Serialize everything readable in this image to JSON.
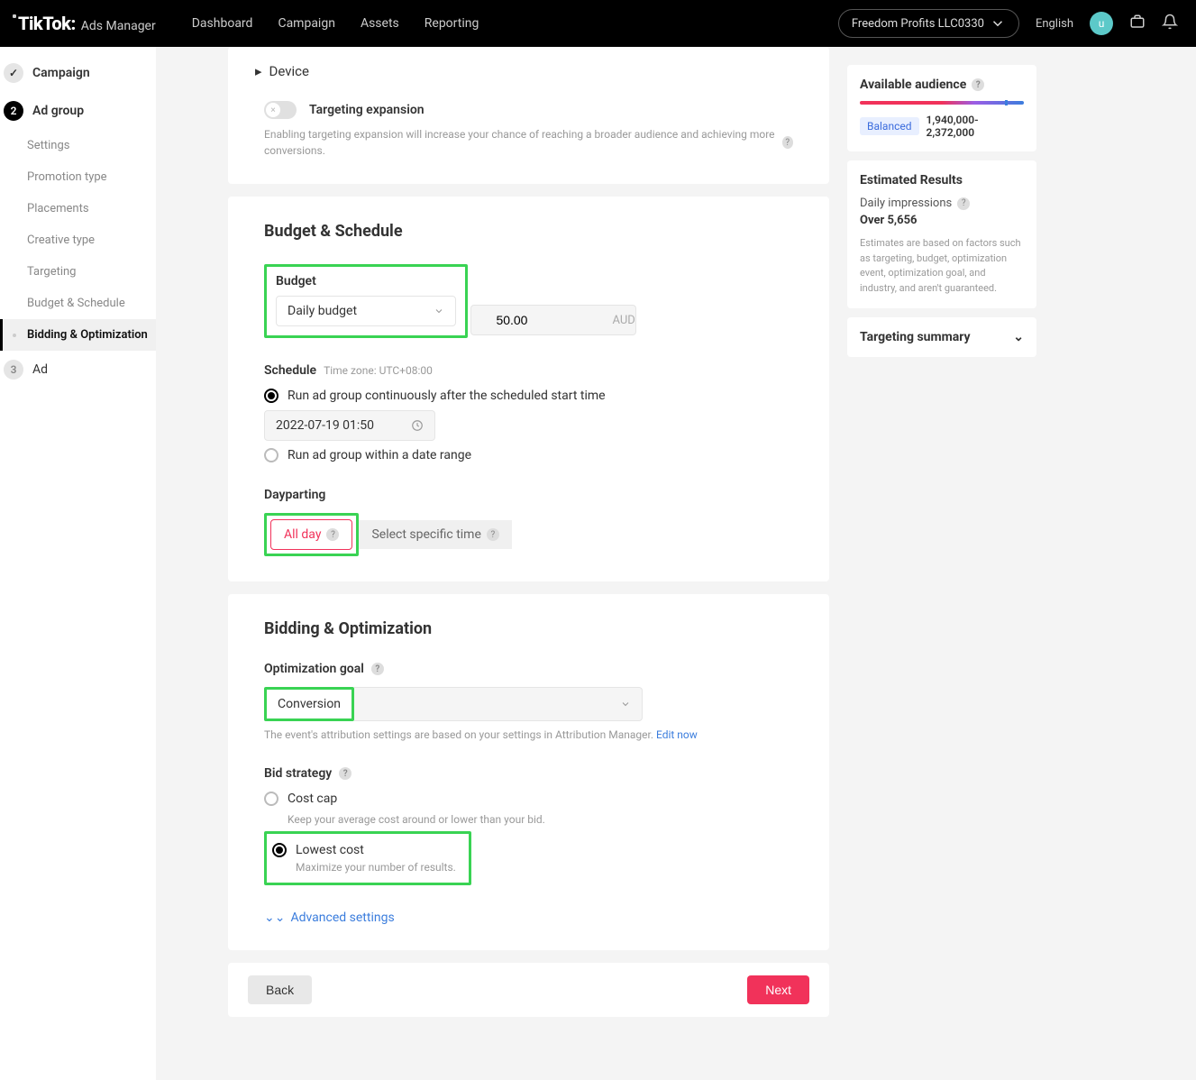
{
  "topbar": {
    "logo_main": "TikTok:",
    "logo_sub": "Ads Manager",
    "nav": [
      "Dashboard",
      "Campaign",
      "Assets",
      "Reporting"
    ],
    "account": "Freedom Profits LLC0330",
    "language": "English",
    "avatar_letter": "u"
  },
  "sidebar": {
    "steps": [
      {
        "label": "Campaign",
        "state": "done"
      },
      {
        "label": "Ad group",
        "state": "current",
        "num": "2"
      },
      {
        "label": "Ad",
        "state": "pending",
        "num": "3"
      }
    ],
    "subitems": [
      "Settings",
      "Promotion type",
      "Placements",
      "Creative type",
      "Targeting",
      "Budget & Schedule",
      "Bidding & Optimization"
    ],
    "active_index": 6
  },
  "device": {
    "label": "Device"
  },
  "targeting_expansion": {
    "title": "Targeting expansion",
    "desc": "Enabling targeting expansion will increase your chance of reaching a broader audience and achieving more conversions."
  },
  "budget_schedule": {
    "heading": "Budget & Schedule",
    "budget_label": "Budget",
    "budget_type": "Daily budget",
    "budget_value": "50.00",
    "currency": "AUD",
    "schedule_label": "Schedule",
    "timezone": "Time zone: UTC+08:00",
    "opt_continuous": "Run ad group continuously after the scheduled start time",
    "start_datetime": "2022-07-19 01:50",
    "opt_range": "Run ad group within a date range",
    "dayparting_label": "Dayparting",
    "dayparting_all": "All day",
    "dayparting_specific": "Select specific time"
  },
  "bidding": {
    "heading": "Bidding & Optimization",
    "opt_goal_label": "Optimization goal",
    "opt_goal_value": "Conversion",
    "attr_hint": "The event's attribution settings are based on your settings in Attribution Manager.",
    "edit_now": "Edit now",
    "bid_strategy_label": "Bid strategy",
    "cost_cap": "Cost cap",
    "cost_cap_desc": "Keep your average cost around or lower than your bid.",
    "lowest_cost": "Lowest cost",
    "lowest_cost_desc": "Maximize your number of results.",
    "advanced": "Advanced settings"
  },
  "footer": {
    "back": "Back",
    "next": "Next"
  },
  "right": {
    "audience_title": "Available audience",
    "balanced": "Balanced",
    "audience_range": "1,940,000-2,372,000",
    "est_title": "Estimated Results",
    "daily_impressions_label": "Daily impressions",
    "daily_impressions_value": "Over 5,656",
    "est_note": "Estimates are based on factors such as targeting, budget, optimization event, optimization goal, and industry, and aren't guaranteed.",
    "targeting_summary": "Targeting summary"
  }
}
